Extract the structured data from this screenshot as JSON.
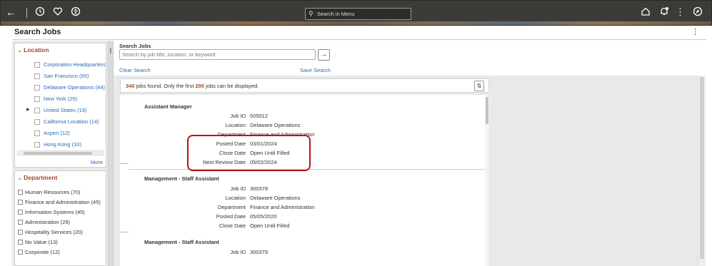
{
  "topbar": {
    "search_placeholder": "Search in Menu",
    "icons": [
      "back-arrow-icon",
      "history-icon",
      "favorites-icon",
      "accessibility-icon",
      "home-icon",
      "notifications-icon",
      "actions-menu-icon",
      "navigator-icon"
    ]
  },
  "page": {
    "title": "Search Jobs"
  },
  "location_facet": {
    "header": "Location",
    "items": [
      "Corporation Headquarters",
      "San Francisco (65)",
      "Delaware Operations (44)",
      "New York (25)",
      "United States (19)",
      "California Location (14)",
      "Aspen (12)",
      "Hong Kong (10)"
    ],
    "more": "More"
  },
  "department_facet": {
    "header": "Department",
    "items": [
      "Human Resources (70)",
      "Finance and Administration (45)",
      "Information Systems (45)",
      "Administration (29)",
      "Hospitality Services (20)",
      "No Value (13)",
      "Corporate (12)"
    ]
  },
  "search": {
    "label": "Search Jobs",
    "placeholder": "Search by job title, location, or keyword",
    "clear": "Clear Search",
    "save": "Save Search",
    "go_symbol": "→"
  },
  "results": {
    "count": "340",
    "mid_text": " jobs found. Only the first ",
    "limit": "200",
    "end_text": " jobs can be displayed.",
    "sort_symbol": "⇅"
  },
  "field_labels": {
    "job_id": "Job ID",
    "location": "Location",
    "department": "Department",
    "posted_date": "Posted Date",
    "close_date": "Close Date",
    "next_review_date": "Next Review Date"
  },
  "jobs": [
    {
      "title": "Assistant Manager",
      "job_id": "505012",
      "location": "Delaware Operations",
      "department": "Finance and Administration",
      "posted_date": "03/01/2024",
      "close_date": "Open Until Filled",
      "next_review_date": "05/02/2024"
    },
    {
      "title": "Management - Staff Assistant",
      "job_id": "300378",
      "location": "Delaware Operations",
      "department": "Finance and Administration",
      "posted_date": "05/05/2020",
      "close_date": "Open Until Filled"
    },
    {
      "title": "Management - Staff Assistant",
      "job_id": "300379"
    }
  ],
  "colors": {
    "highlight": "#b3161c",
    "link": "#2a6ab1",
    "facet_header": "#9c4a2a"
  }
}
